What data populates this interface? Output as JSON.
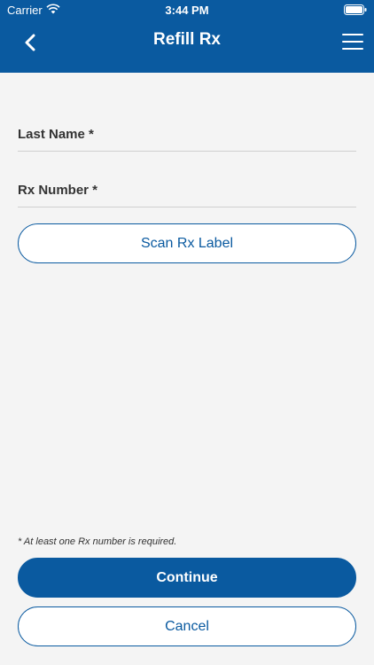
{
  "status_bar": {
    "carrier": "Carrier",
    "time": "3:44 PM"
  },
  "header": {
    "title": "Refill Rx",
    "back_icon": "chevron-left-icon",
    "menu_icon": "hamburger-menu-icon"
  },
  "form": {
    "last_name_label": "Last Name *",
    "rx_number_label": "Rx Number *",
    "scan_label": "Scan Rx Label",
    "footnote": "* At least one Rx number is required.",
    "continue_label": "Continue",
    "cancel_label": "Cancel"
  },
  "colors": {
    "brand": "#0a5aa0",
    "background": "#f4f4f4"
  }
}
